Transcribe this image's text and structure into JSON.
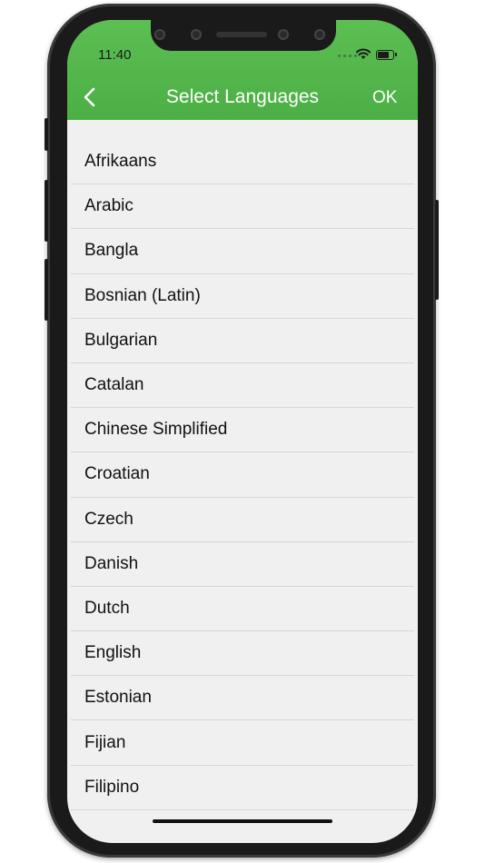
{
  "status_bar": {
    "time": "11:40",
    "wifi_icon": "wifi-icon",
    "battery_icon": "battery-icon"
  },
  "header": {
    "back_icon": "chevron-left-icon",
    "title": "Select Languages",
    "ok_label": "OK",
    "background_color": "#4caf46",
    "text_color": "#ffffff"
  },
  "languages": [
    "Afrikaans",
    "Arabic",
    "Bangla",
    "Bosnian (Latin)",
    "Bulgarian",
    "Catalan",
    "Chinese Simplified",
    "Croatian",
    "Czech",
    "Danish",
    "Dutch",
    "English",
    "Estonian",
    "Fijian",
    "Filipino"
  ]
}
